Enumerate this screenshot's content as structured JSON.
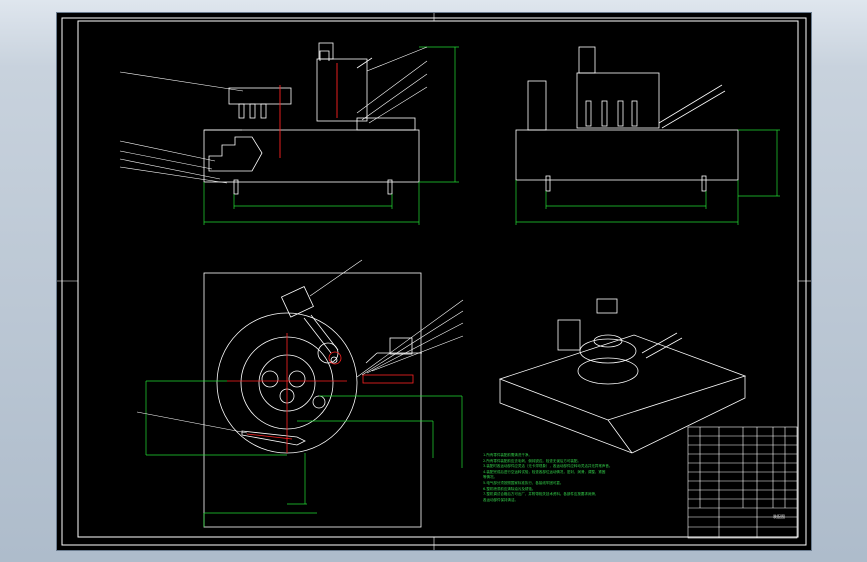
{
  "window": {
    "background": "#000000",
    "line_color": "#ffffff",
    "dim_color": "#22dd33",
    "accent": "#ff2222"
  },
  "technical_notes": {
    "lines": [
      "1.所有零件装配前需清洗干净。",
      "2.所有零件装配前应去毛刺，倒钝锐边。检查无误后方可装配。",
      "3.装配时各运动部件应灵活（无卡滞现象），各运动部件应转动灵活并无异常声音。",
      "4.装配完成后进行空运转试验，检查各部位运动情况，密封，润滑，调整，紧固",
      "   等情况。",
      "5.电气部分须按照国家标准执行，各接线牢固可靠。",
      "6.整机喷漆前应清除油污及锈蚀。",
      "7.整机调试合格后方可出厂，并附带相关技术资料。各部件应按要求润滑，",
      "   各运动部件保持清洁。"
    ]
  },
  "title_block": {
    "drawing_label": "装配图"
  }
}
